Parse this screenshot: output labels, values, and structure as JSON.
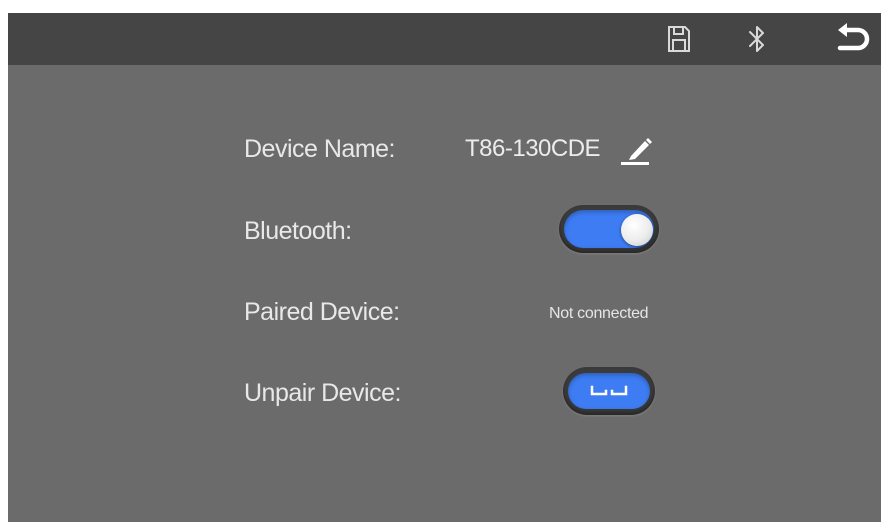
{
  "topbar": {
    "save_icon": "save-icon",
    "bluetooth_icon": "bluetooth-icon",
    "back_icon": "back-arrow-icon"
  },
  "settings": {
    "device_name_label": "Device Name:",
    "device_name_value": "T86-130CDE",
    "bluetooth_label": "Bluetooth:",
    "bluetooth_enabled": true,
    "paired_device_label": "Paired Device:",
    "paired_device_value": "Not connected",
    "unpair_device_label": "Unpair Device:"
  },
  "colors": {
    "background": "#6b6b6b",
    "topbar": "#454545",
    "accent": "#3d7cf2",
    "text": "#e8e8e8"
  }
}
